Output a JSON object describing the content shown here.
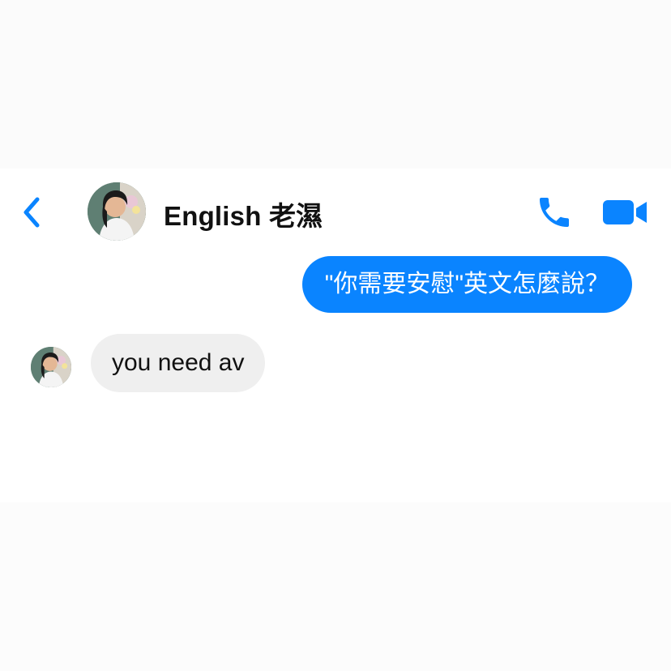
{
  "header": {
    "contact_name": "English 老濕",
    "back_icon": "chevron-left-icon",
    "call_icon": "phone-icon",
    "video_icon": "video-camera-icon"
  },
  "messages": [
    {
      "direction": "outgoing",
      "text": "\"你需要安慰\"英文怎麼說？"
    },
    {
      "direction": "incoming",
      "text": "you need av"
    }
  ],
  "colors": {
    "accent": "#0a84ff",
    "incoming_bubble": "#efefef",
    "text_dark": "#111111",
    "background": "#ffffff"
  }
}
